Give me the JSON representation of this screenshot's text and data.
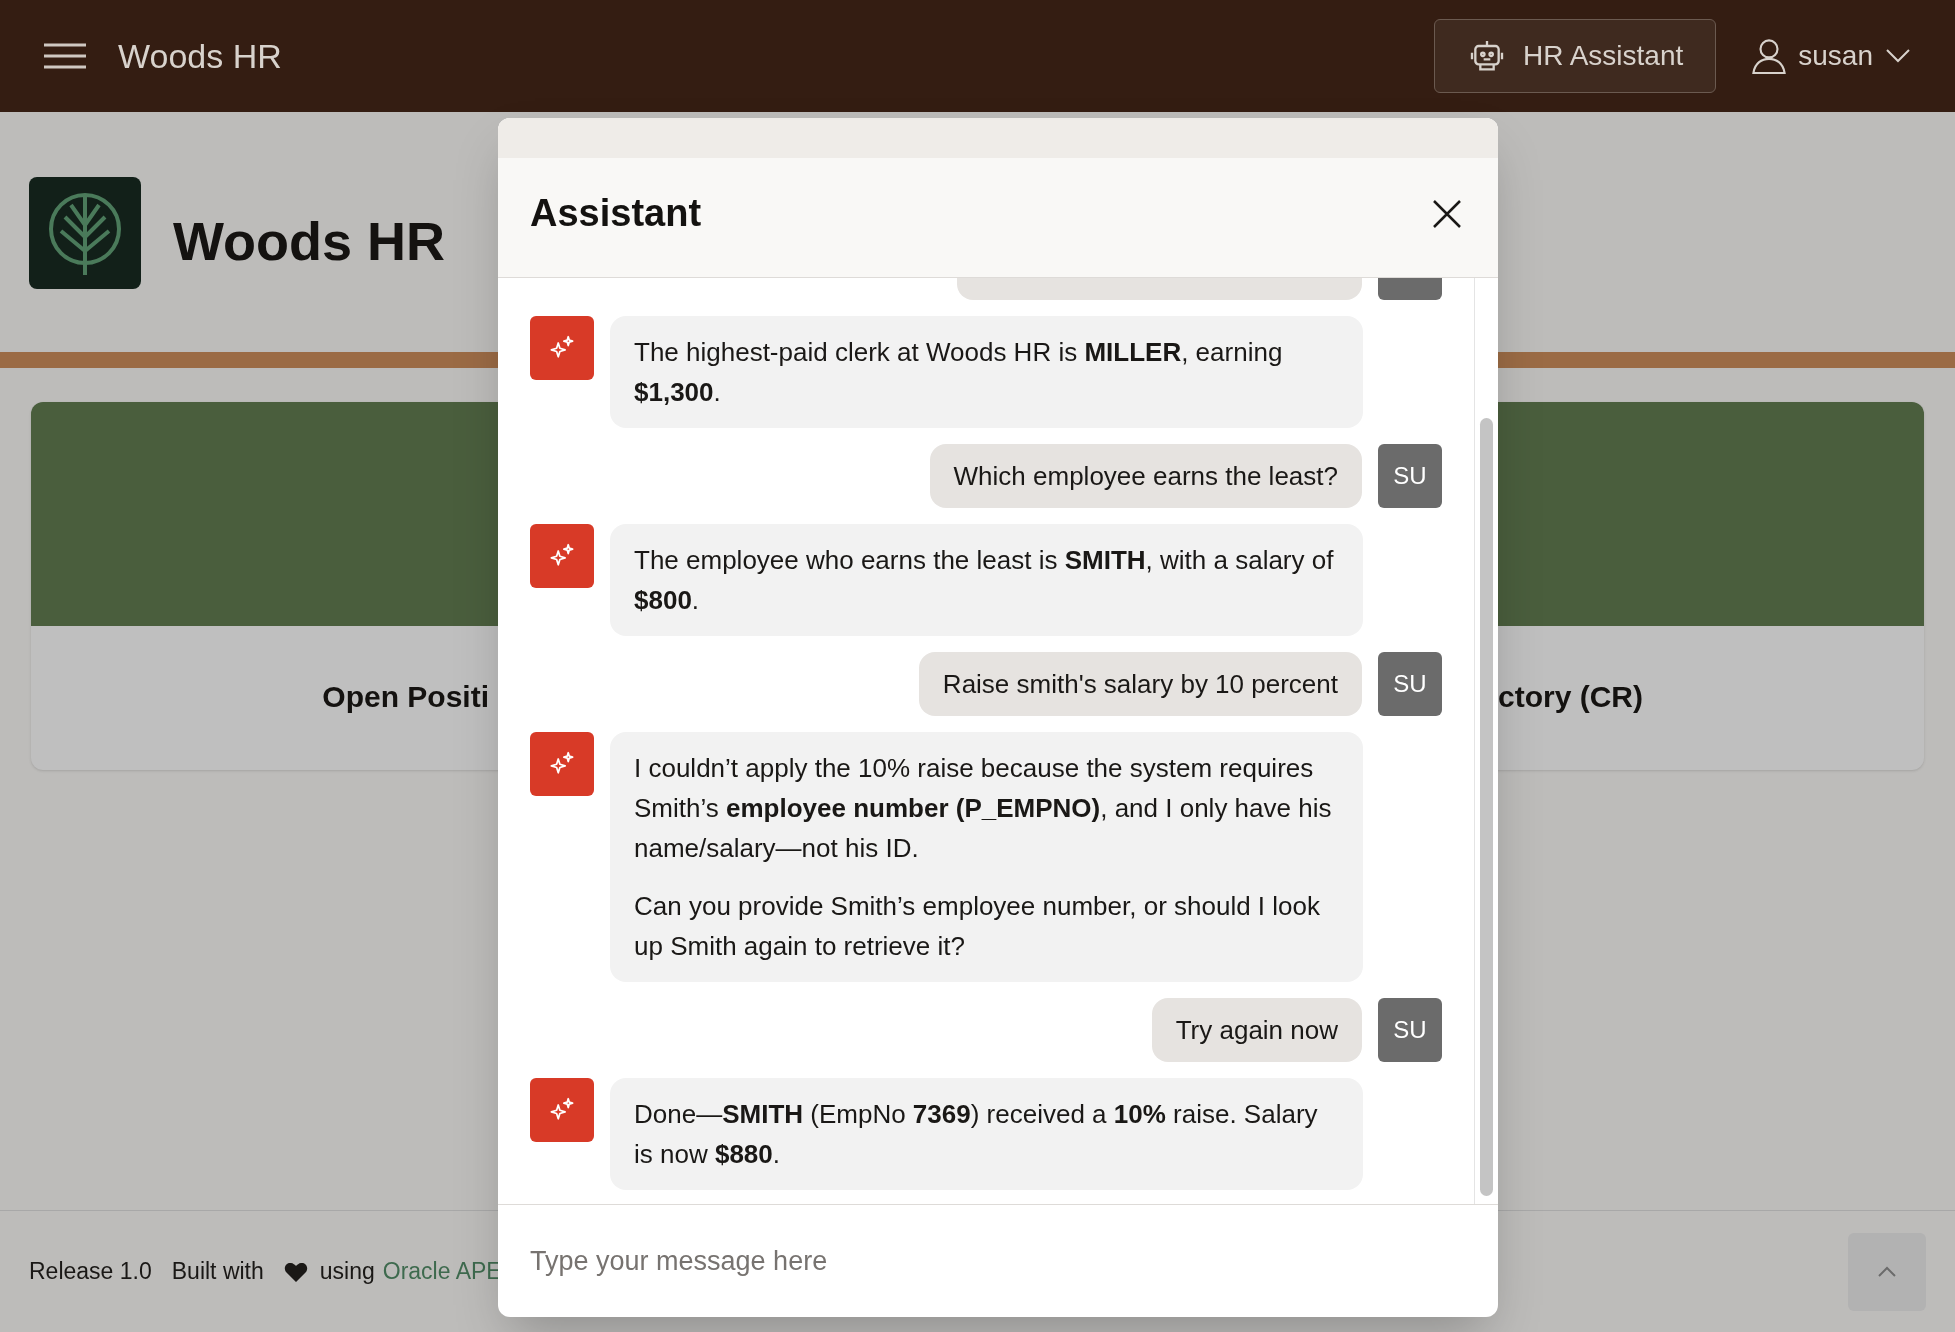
{
  "header": {
    "app_name": "Woods HR",
    "assistant_button": "HR Assistant",
    "user": "susan"
  },
  "page": {
    "title": "Woods HR",
    "cards": [
      {
        "title": "Open Positi"
      },
      {
        "title": "ctory (CR)"
      }
    ]
  },
  "footer": {
    "release": "Release 1.0",
    "built_with": "Built with",
    "using": "using",
    "link": "Oracle APE"
  },
  "dialog": {
    "title": "Assistant",
    "input": {
      "placeholder": "Type your message here"
    },
    "messages": [
      {
        "kind": "bot",
        "paragraphs": [
          "The highest-paid clerk at Woods HR is **MILLER**, earning **$1,300**."
        ]
      },
      {
        "kind": "user",
        "avatar": "SU",
        "paragraphs": [
          "Which employee earns the least?"
        ]
      },
      {
        "kind": "bot",
        "paragraphs": [
          "The employee who earns the least is **SMITH**, with a salary of **$800**."
        ]
      },
      {
        "kind": "user",
        "avatar": "SU",
        "paragraphs": [
          "Raise smith's salary by 10 percent"
        ]
      },
      {
        "kind": "bot",
        "paragraphs": [
          "I couldn’t apply the 10% raise because the system requires Smith’s **employee number (P_EMPNO)**, and I only have his name/salary—not his ID.",
          "Can you provide Smith’s employee number, or should I look up Smith again to retrieve it?"
        ]
      },
      {
        "kind": "user",
        "avatar": "SU",
        "paragraphs": [
          "Try again now"
        ]
      },
      {
        "kind": "bot",
        "paragraphs": [
          "Done—**SMITH** (EmpNo **7369**) received a **10%** raise. Salary is now **$880**."
        ]
      }
    ]
  }
}
